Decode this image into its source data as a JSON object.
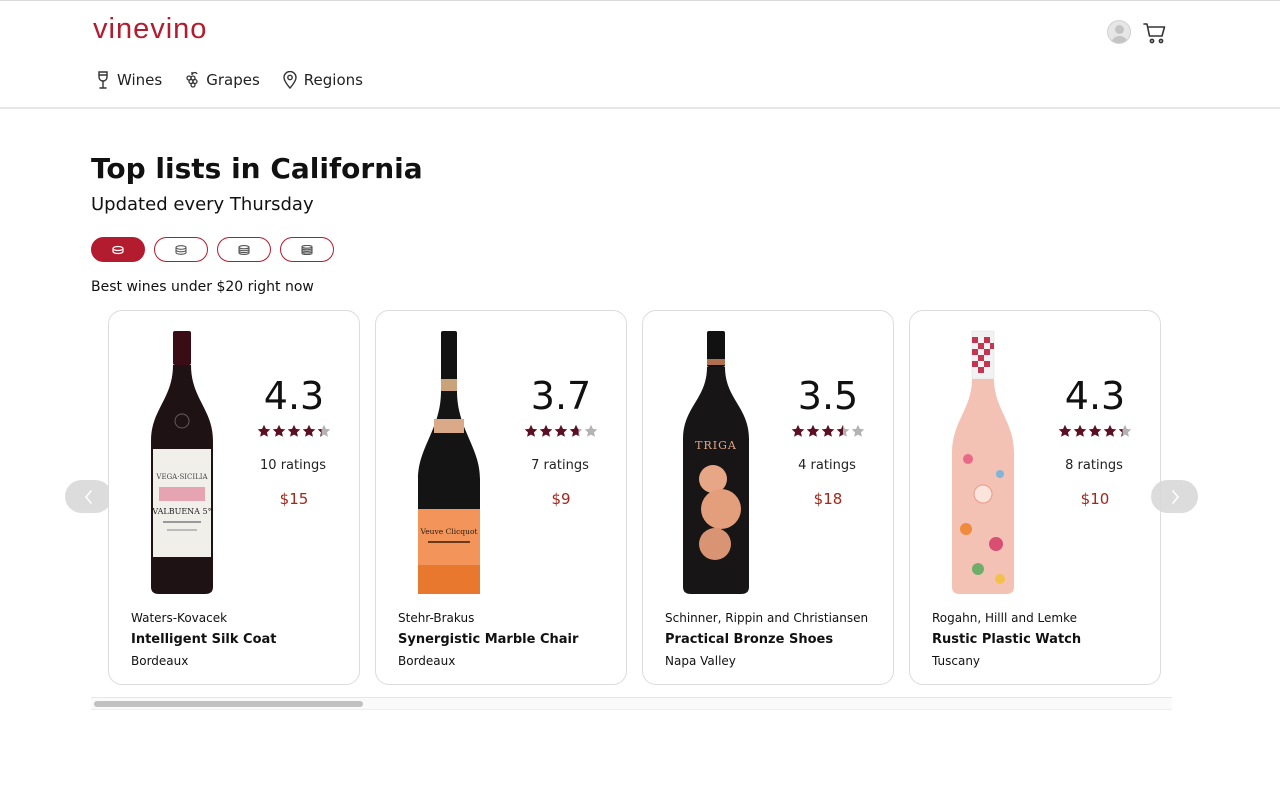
{
  "brand": {
    "logo": "vinevino",
    "accent": "#b31b2e"
  },
  "header": {
    "avatar_icon": "user-avatar-icon",
    "cart_icon": "cart-icon"
  },
  "nav": {
    "items": [
      {
        "label": "Wines",
        "icon": "wine-glass-icon"
      },
      {
        "label": "Grapes",
        "icon": "grapes-icon"
      },
      {
        "label": "Regions",
        "icon": "location-pin-icon"
      }
    ]
  },
  "page": {
    "title": "Top lists in California",
    "subtitle": "Updated every Thursday",
    "list_label": "Best wines under $20 right now"
  },
  "filters": {
    "chips": [
      {
        "icon": "coin-stack-1-icon",
        "active": true
      },
      {
        "icon": "coin-stack-2-icon",
        "active": false
      },
      {
        "icon": "coin-stack-3-icon",
        "active": false
      },
      {
        "icon": "coin-stack-4-icon",
        "active": false
      }
    ]
  },
  "wines": [
    {
      "rating": "4.3",
      "stars": 4.3,
      "ratings_count": "10 ratings",
      "price": "$15",
      "producer": "Waters-Kovacek",
      "name": "Intelligent Silk Coat",
      "region": "Bordeaux",
      "bottle_style": "red"
    },
    {
      "rating": "3.7",
      "stars": 3.7,
      "ratings_count": "7 ratings",
      "price": "$9",
      "producer": "Stehr-Brakus",
      "name": "Synergistic Marble Chair",
      "region": "Bordeaux",
      "bottle_style": "champagne"
    },
    {
      "rating": "3.5",
      "stars": 3.5,
      "ratings_count": "4 ratings",
      "price": "$18",
      "producer": "Schinner, Rippin and Christiansen",
      "name": "Practical Bronze Shoes",
      "region": "Napa Valley",
      "bottle_style": "triga"
    },
    {
      "rating": "4.3",
      "stars": 4.3,
      "ratings_count": "8 ratings",
      "price": "$10",
      "producer": "Rogahn, Hilll and Lemke",
      "name": "Rustic Plastic Watch",
      "region": "Tuscany",
      "bottle_style": "rose"
    }
  ],
  "colors": {
    "star_filled": "#5a0f24",
    "star_empty": "#b3b3b3",
    "price": "#a3261a"
  },
  "carousel": {
    "prev_icon": "chevron-left-icon",
    "next_icon": "chevron-right-icon",
    "scroll_position": 0
  }
}
